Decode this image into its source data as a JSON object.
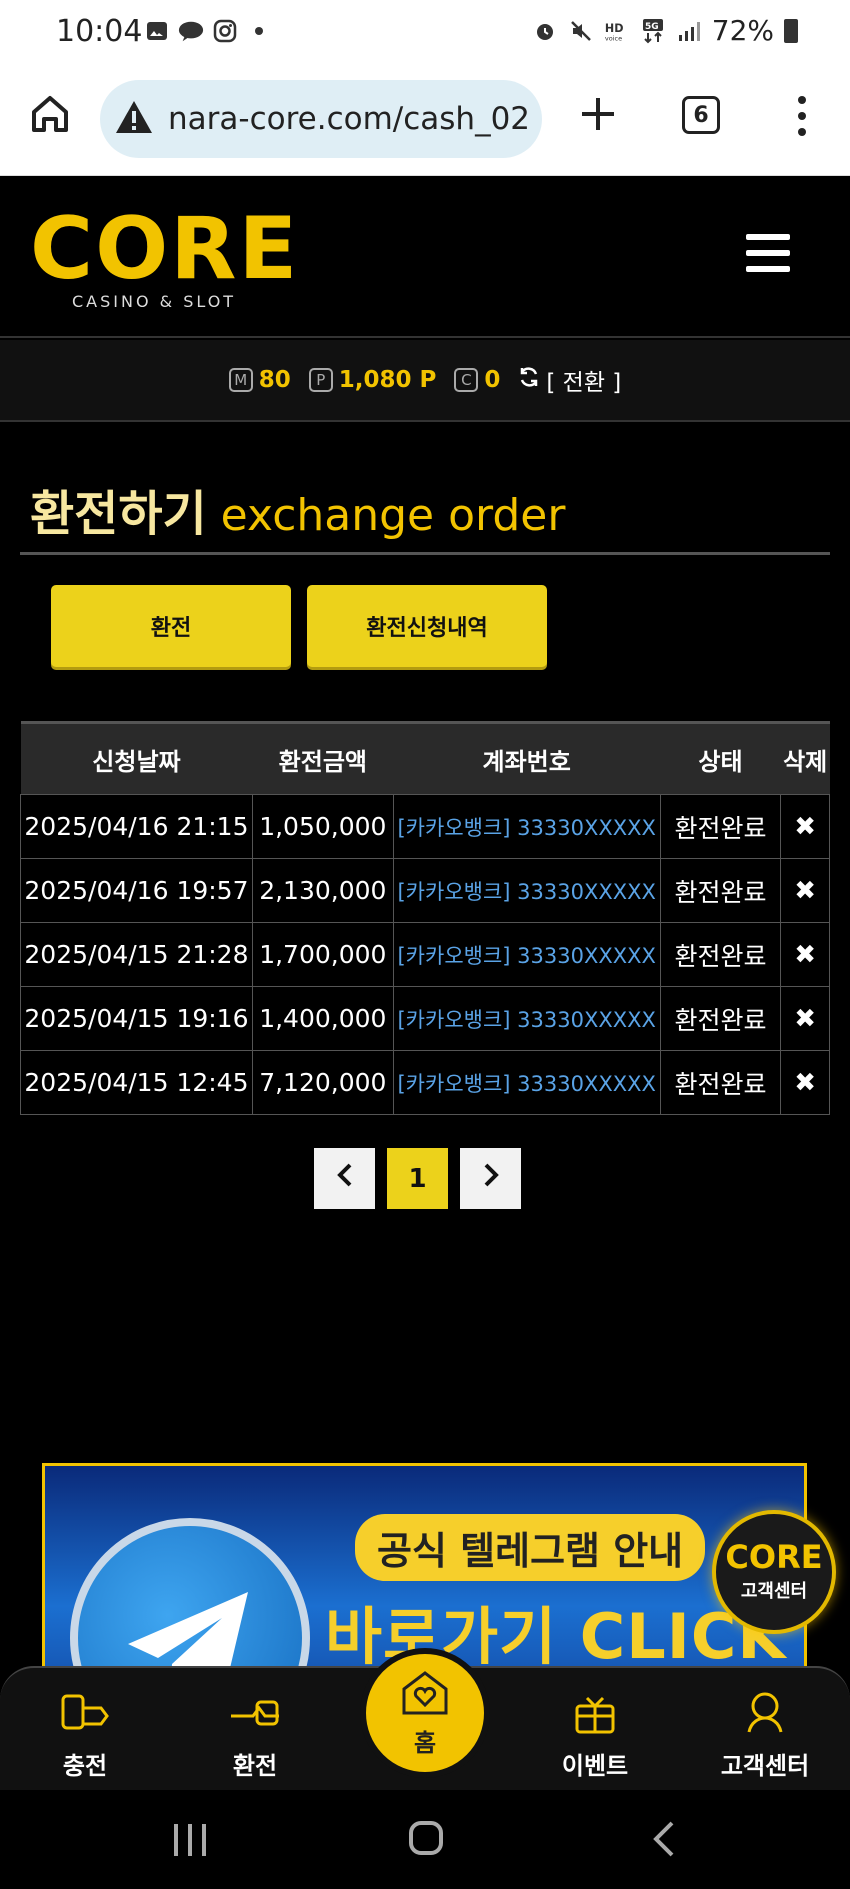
{
  "status_bar": {
    "time": "10:04",
    "battery": "72%",
    "network": "5G"
  },
  "browser": {
    "url": "nara-core.com/cash_02",
    "tab_count": "6"
  },
  "site": {
    "logo_word": "CORE",
    "logo_sub": "CASINO & SLOT"
  },
  "balance": {
    "m_badge": "M",
    "m_value": "80",
    "p_badge": "P",
    "p_value": "1,080 P",
    "c_badge": "C",
    "c_value": "0",
    "convert_label": "[ 전환 ]"
  },
  "page": {
    "title_ko": "환전하기",
    "title_en": "exchange order"
  },
  "actions": {
    "exchange": "환전",
    "history": "환전신청내역"
  },
  "table": {
    "headers": [
      "신청날짜",
      "환전금액",
      "계좌번호",
      "상태",
      "삭제"
    ],
    "rows": [
      {
        "date": "2025/04/16 21:15",
        "amount": "1,050,000",
        "account": "[카카오뱅크] 33330XXXXX",
        "status": "환전완료"
      },
      {
        "date": "2025/04/16 19:57",
        "amount": "2,130,000",
        "account": "[카카오뱅크] 33330XXXXX",
        "status": "환전완료"
      },
      {
        "date": "2025/04/15 21:28",
        "amount": "1,700,000",
        "account": "[카카오뱅크] 33330XXXXX",
        "status": "환전완료"
      },
      {
        "date": "2025/04/15 19:16",
        "amount": "1,400,000",
        "account": "[카카오뱅크] 33330XXXXX",
        "status": "환전완료"
      },
      {
        "date": "2025/04/15 12:45",
        "amount": "7,120,000",
        "account": "[카카오뱅크] 33330XXXXX",
        "status": "환전완료"
      }
    ]
  },
  "pagination": {
    "current": "1"
  },
  "banner": {
    "line1": "공식 텔레그램 안내",
    "line2": "바로가기 CLICK"
  },
  "cs_bubble": {
    "word": "CORE",
    "label": "고객센터"
  },
  "bottom_nav": {
    "charge": "충전",
    "exchange": "환전",
    "home": "홈",
    "event": "이벤트",
    "support": "고객센터"
  },
  "colors": {
    "accent": "#f2c300",
    "button": "#ecd21b",
    "link": "#5aa3e6"
  }
}
